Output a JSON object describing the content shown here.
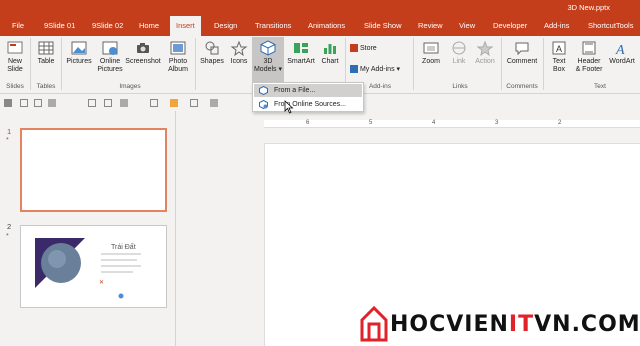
{
  "window": {
    "document_title": "3D New.pptx"
  },
  "tabs": [
    {
      "label": "File"
    },
    {
      "label": "9Slide 01"
    },
    {
      "label": "9Slide 02"
    },
    {
      "label": "Home"
    },
    {
      "label": "Insert"
    },
    {
      "label": "Design"
    },
    {
      "label": "Transitions"
    },
    {
      "label": "Animations"
    },
    {
      "label": "Slide Show"
    },
    {
      "label": "Review"
    },
    {
      "label": "View"
    },
    {
      "label": "Developer"
    },
    {
      "label": "Add-ins"
    },
    {
      "label": "ShortcutTools"
    }
  ],
  "active_tab": "Insert",
  "ribbon": {
    "new_slide": {
      "line1": "New",
      "line2": "Slide"
    },
    "table": {
      "line1": "Table",
      "line2": ""
    },
    "pictures": {
      "line1": "Pictures",
      "line2": ""
    },
    "online_pictures": {
      "line1": "Online",
      "line2": "Pictures"
    },
    "screenshot": {
      "line1": "Screenshot",
      "line2": ""
    },
    "photo_album": {
      "line1": "Photo",
      "line2": "Album"
    },
    "shapes": {
      "line1": "Shapes",
      "line2": ""
    },
    "icons": {
      "line1": "Icons",
      "line2": ""
    },
    "models_3d": {
      "line1": "3D",
      "line2": "Models"
    },
    "smartart": {
      "line1": "SmartArt",
      "line2": ""
    },
    "chart": {
      "line1": "Chart",
      "line2": ""
    },
    "store": {
      "label": "Store"
    },
    "my_addins": {
      "label": "My Add-ins"
    },
    "zoom": {
      "line1": "Zoom",
      "line2": ""
    },
    "link": {
      "line1": "Link",
      "line2": ""
    },
    "action": {
      "line1": "Action",
      "line2": ""
    },
    "comment": {
      "line1": "Comment",
      "line2": ""
    },
    "text_box": {
      "line1": "Text",
      "line2": "Box"
    },
    "header_footer": {
      "line1": "Header",
      "line2": "& Footer"
    },
    "wordart": {
      "line1": "WordArt",
      "line2": ""
    },
    "groups": {
      "slides": "Slides",
      "tables": "Tables",
      "images": "Images",
      "addins": "Add-ins",
      "links": "Links",
      "comments": "Comments",
      "text": "Text"
    }
  },
  "dropdown": {
    "items": [
      {
        "label": "From a File..."
      },
      {
        "label": "From Online Sources..."
      }
    ]
  },
  "ruler": {
    "numbers": [
      "6",
      "5",
      "4",
      "3",
      "2"
    ]
  },
  "slides": [
    {
      "number": "1",
      "marker": "*"
    },
    {
      "number": "2",
      "marker": "*",
      "heading": "Trái Đất"
    }
  ],
  "watermark": {
    "prefix": "HOCVIEN",
    "accent": "IT",
    "suffix": "VN.COM"
  },
  "colors": {
    "accent": "#c43e1c",
    "selection_border": "#e4835f",
    "watermark_red": "#e0222a"
  }
}
